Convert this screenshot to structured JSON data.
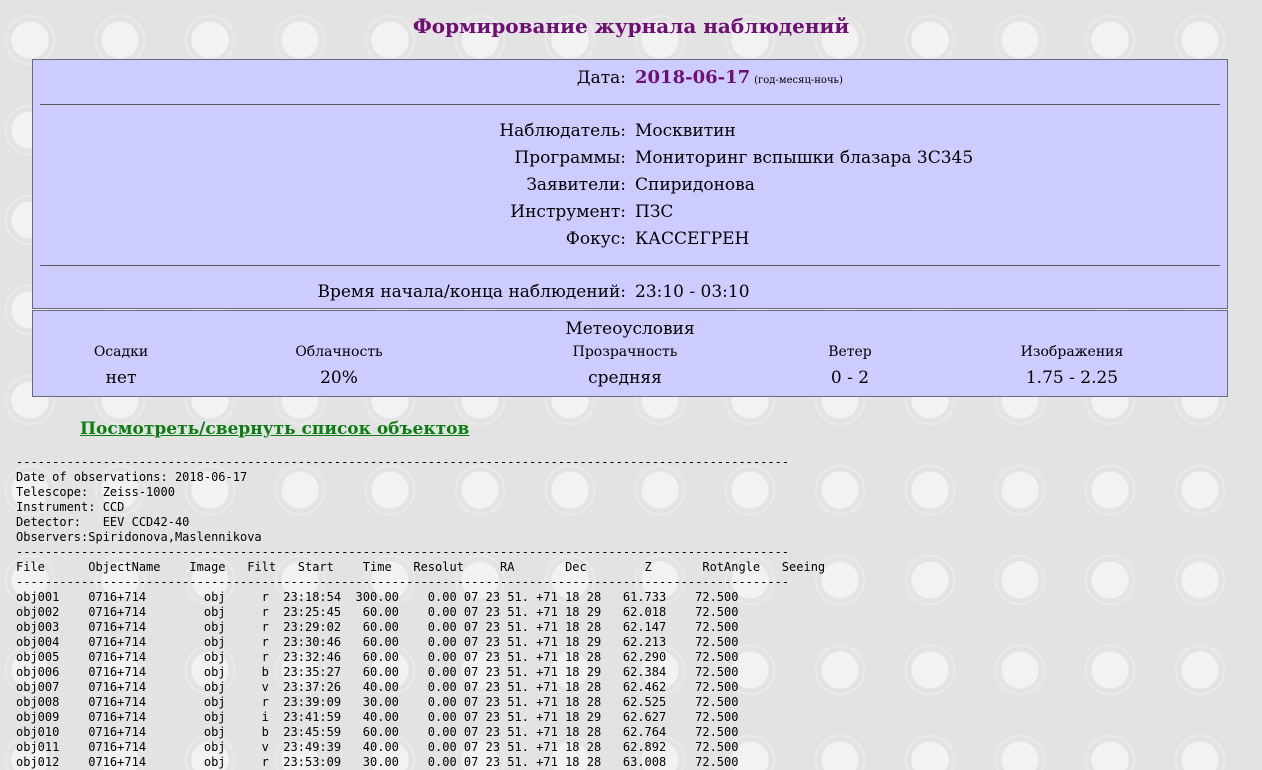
{
  "page_title": "Формирование журнала наблюдений",
  "info": {
    "date_label": "Дата:",
    "date_value": "2018-06-17",
    "date_hint": "(год-месяц-ночь)",
    "observer_label": "Наблюдатель:",
    "observer_value": "Москвитин",
    "programs_label": "Программы:",
    "programs_value": "Мониторинг вспышки блазара 3С345",
    "applicants_label": "Заявители:",
    "applicants_value": "Спиридонова",
    "instrument_label": "Инструмент:",
    "instrument_value": "ПЗС",
    "focus_label": "Фокус:",
    "focus_value": "КАССЕГРЕН",
    "time_label": "Время начала/конца наблюдений:",
    "time_value": "23:10 - 03:10"
  },
  "meteo": {
    "title": "Метеоусловия",
    "columns": [
      {
        "header": "Осадки",
        "value": "нет"
      },
      {
        "header": "Облачность",
        "value": "20%"
      },
      {
        "header": "Прозрачность",
        "value": "средняя"
      },
      {
        "header": "Ветер",
        "value": "0 - 2"
      },
      {
        "header": "Изображения",
        "value": "1.75 - 2.25"
      }
    ]
  },
  "toggle_link": "Посмотреть/свернуть список объектов",
  "log": {
    "separator": "-----------------------------------------------------------------------------------------------------------",
    "date_line": "Date of observations: 2018-06-17",
    "telescope_line": "Telescope:  Zeiss-1000",
    "instrument_line": "Instrument: CCD",
    "detector_line": "Detector:   EEV CCD42-40",
    "observers_line": "Observers:Spiridonova,Maslennikova",
    "header_line": "File      ObjectName    Image   Filt   Start    Time   Resolut     RA       Dec        Z       RotAngle   Seeing",
    "rows": [
      "obj001    0716+714        obj     r  23:18:54  300.00    0.00 07 23 51. +71 18 28   61.733    72.500",
      "obj002    0716+714        obj     r  23:25:45   60.00    0.00 07 23 51. +71 18 29   62.018    72.500",
      "obj003    0716+714        obj     r  23:29:02   60.00    0.00 07 23 51. +71 18 28   62.147    72.500",
      "obj004    0716+714        obj     r  23:30:46   60.00    0.00 07 23 51. +71 18 29   62.213    72.500",
      "obj005    0716+714        obj     r  23:32:46   60.00    0.00 07 23 51. +71 18 28   62.290    72.500",
      "obj006    0716+714        obj     b  23:35:27   60.00    0.00 07 23 51. +71 18 29   62.384    72.500",
      "obj007    0716+714        obj     v  23:37:26   40.00    0.00 07 23 51. +71 18 28   62.462    72.500",
      "obj008    0716+714        obj     r  23:39:09   30.00    0.00 07 23 51. +71 18 28   62.525    72.500",
      "obj009    0716+714        obj     i  23:41:59   40.00    0.00 07 23 51. +71 18 29   62.627    72.500",
      "obj010    0716+714        obj     b  23:45:59   60.00    0.00 07 23 51. +71 18 28   62.764    72.500",
      "obj011    0716+714        obj     v  23:49:39   40.00    0.00 07 23 51. +71 18 28   62.892    72.500",
      "obj012    0716+714        obj     r  23:53:09   30.00    0.00 07 23 51. +71 18 28   63.008    72.500"
    ]
  }
}
